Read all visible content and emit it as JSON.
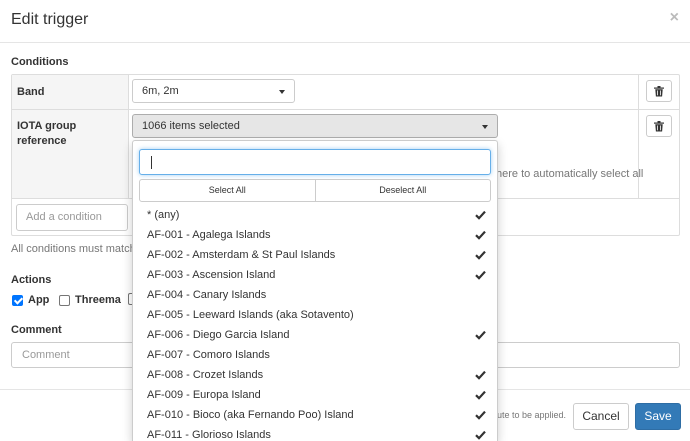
{
  "modal": {
    "title": "Edit trigger",
    "close": "×"
  },
  "conditions": {
    "heading": "Conditions",
    "band": {
      "label": "Band",
      "value": "6m, 2m"
    },
    "iota": {
      "label_line1": "IOTA group",
      "label_line2": "reference",
      "value": "1066 items selected",
      "help_tail": "here to automatically select all"
    },
    "add_placeholder": "Add a condition",
    "match_note": "All conditions must match"
  },
  "actions": {
    "heading": "Actions",
    "items": [
      {
        "label": "App",
        "checked": true
      },
      {
        "label": "Threema",
        "checked": false
      }
    ]
  },
  "comment": {
    "heading": "Comment",
    "placeholder": "Comment"
  },
  "footer": {
    "note": "ute to be applied.",
    "cancel": "Cancel",
    "save": "Save"
  },
  "dropdown": {
    "search_value": "",
    "select_all": "Select All",
    "deselect_all": "Deselect All",
    "items": [
      {
        "label": "* (any)",
        "checked": true
      },
      {
        "label": "AF-001 - Agalega Islands",
        "checked": true
      },
      {
        "label": "AF-002 - Amsterdam & St Paul Islands",
        "checked": true
      },
      {
        "label": "AF-003 - Ascension Island",
        "checked": true
      },
      {
        "label": "AF-004 - Canary Islands",
        "checked": false
      },
      {
        "label": "AF-005 - Leeward Islands (aka Sotavento)",
        "checked": false
      },
      {
        "label": "AF-006 - Diego Garcia Island",
        "checked": true
      },
      {
        "label": "AF-007 - Comoro Islands",
        "checked": false
      },
      {
        "label": "AF-008 - Crozet Islands",
        "checked": true
      },
      {
        "label": "AF-009 - Europa Island",
        "checked": true
      },
      {
        "label": "AF-010 - Bioco (aka Fernando Poo) Island",
        "checked": true
      },
      {
        "label": "AF-011 - Glorioso Islands",
        "checked": true
      }
    ]
  },
  "colors": {
    "primary": "#337ab7",
    "focus": "#66afe9",
    "checkbox": "#0075ff"
  }
}
